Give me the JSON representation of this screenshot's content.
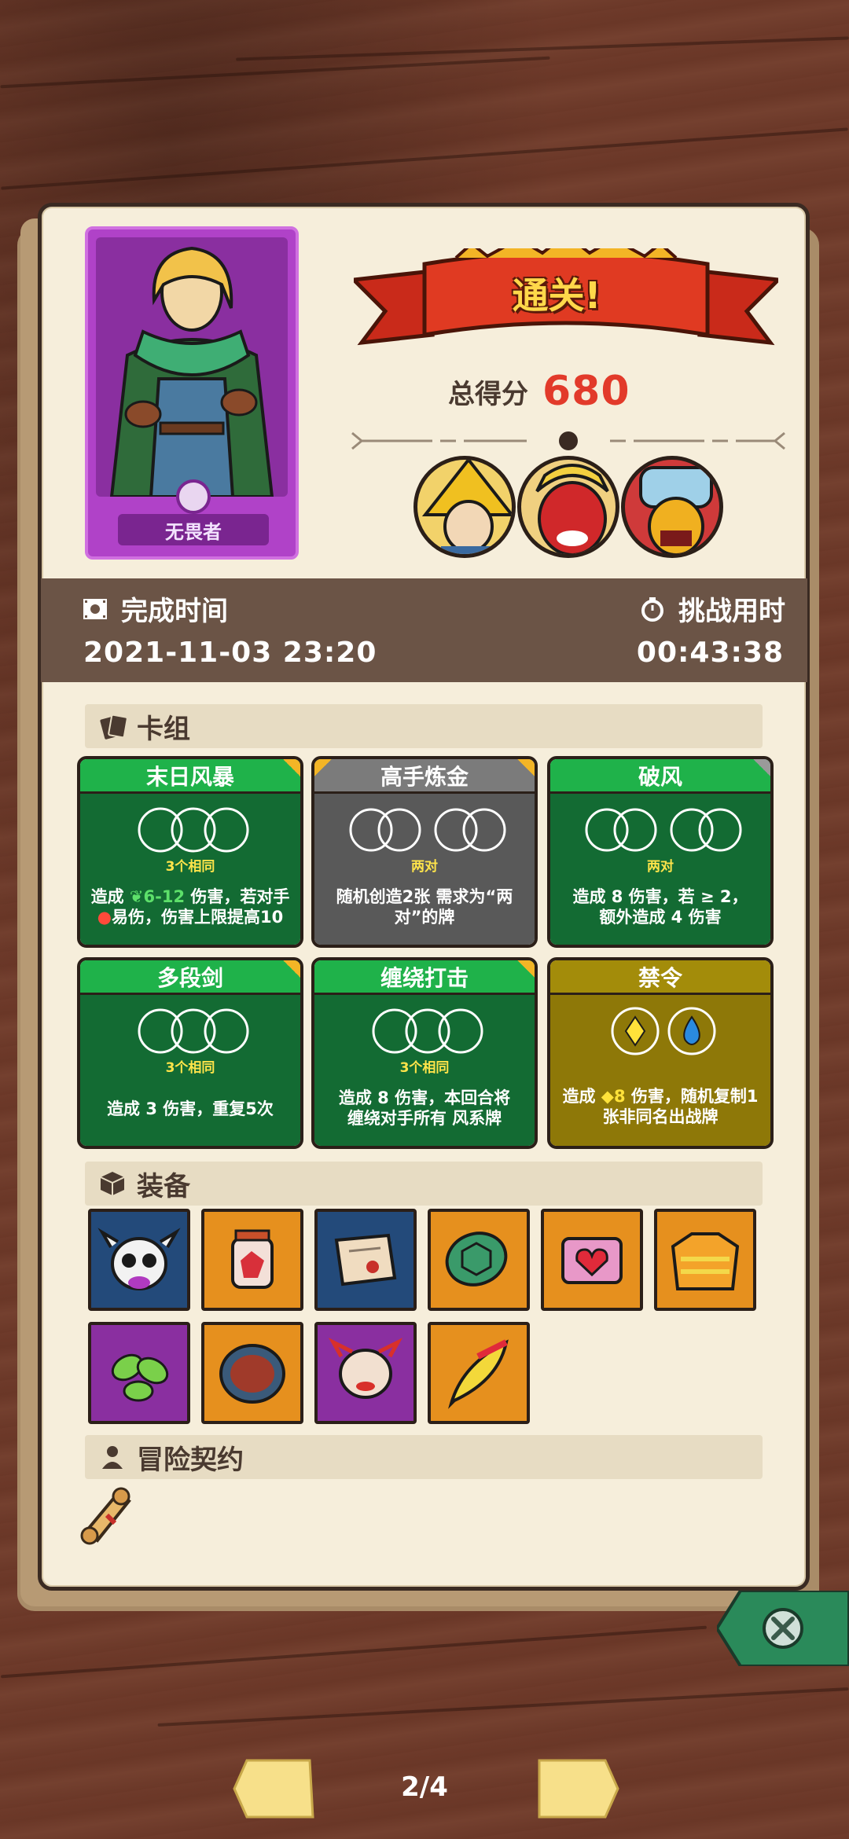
{
  "result": {
    "banner_text": "通关!",
    "score_label": "总得分",
    "score_value": "680"
  },
  "hero": {
    "name": "无畏者"
  },
  "stats": {
    "completion_label": "完成时间",
    "completion_value": "2021-11-03 23:20",
    "challenge_label": "挑战用时",
    "challenge_value": "00:43:38"
  },
  "sections": {
    "deck": "卡组",
    "equipment": "装备",
    "contract": "冒险契约"
  },
  "deck": [
    {
      "title": "末日风暴",
      "condition": "3个相同",
      "line1": "造成 ",
      "dmg": "6-12",
      "line1b": " 伤害，若对手",
      "line2": "易伤，伤害上限提高10",
      "color": "green"
    },
    {
      "title": "高手炼金",
      "condition": "两对",
      "desc": "随机创造2张 需求为“两对”的牌",
      "color": "gray"
    },
    {
      "title": "破风",
      "condition": "两对",
      "desc1": "造成 8 伤害，若 ≥ 2，",
      "desc2": "额外造成 4 伤害",
      "color": "green"
    },
    {
      "title": "多段剑",
      "condition": "3个相同",
      "desc": "造成 3 伤害，重复5次",
      "color": "green"
    },
    {
      "title": "缠绕打击",
      "condition": "3个相同",
      "desc1": "造成 8 伤害，本回合将",
      "desc2": "缠绕对手所有 风系牌",
      "color": "green"
    },
    {
      "title": "禁令",
      "desc1a": "造成 ",
      "dmg": "8",
      "desc1b": " 伤害，随机复制1",
      "desc2": "张非同名出战牌",
      "color": "gold"
    }
  ],
  "pagination": {
    "page": "2/4"
  },
  "colors": {
    "accent_red": "#e23a2a",
    "card_green": "#136b33",
    "card_gray": "#595959",
    "card_gold": "#8e7808",
    "paper": "#f6eedb"
  }
}
